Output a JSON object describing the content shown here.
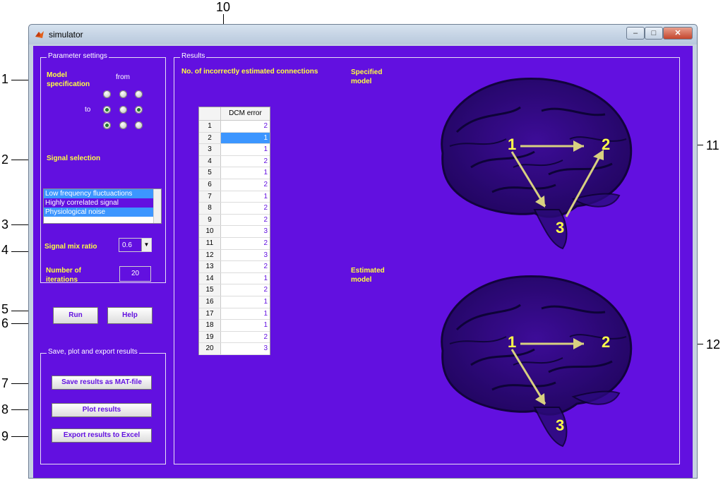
{
  "window": {
    "title": "simulator"
  },
  "titlebar_buttons": {
    "minimize": "–",
    "maximize": "□",
    "close": "✕"
  },
  "callouts": [
    "1",
    "2",
    "3",
    "4",
    "5",
    "6",
    "7",
    "8",
    "9",
    "10",
    "11",
    "12"
  ],
  "parameter_settings": {
    "title": "Parameter settings",
    "model_specification_label": "Model specification",
    "from_label": "from",
    "to_label": "to",
    "radio_grid": [
      [
        false,
        false,
        false
      ],
      [
        true,
        false,
        true
      ],
      [
        true,
        false,
        false
      ]
    ],
    "signal_selection_label": "Signal selection",
    "signal_options": [
      {
        "label": "Low frequency fluctuactions",
        "selected": true
      },
      {
        "label": "Highly correlated signal",
        "selected": false
      },
      {
        "label": "Physiological noise",
        "selected": true
      }
    ],
    "signal_mix_ratio_label": "Signal mix ratio",
    "signal_mix_ratio_value": "0.6",
    "iterations_label": "Number of iterations",
    "iterations_value": "20"
  },
  "actions": {
    "run_label": "Run",
    "help_label": "Help"
  },
  "export_group": {
    "title": "Save, plot and export results",
    "save_label": "Save results as MAT-file",
    "plot_label": "Plot results",
    "export_label": "Export results to Excel"
  },
  "results": {
    "title": "Results",
    "table_title": "No. of incorrectly estimated connections",
    "column_header": "DCM error",
    "rows": [
      {
        "index": "1",
        "value": "2"
      },
      {
        "index": "2",
        "value": "1"
      },
      {
        "index": "3",
        "value": "1"
      },
      {
        "index": "4",
        "value": "2"
      },
      {
        "index": "5",
        "value": "1"
      },
      {
        "index": "6",
        "value": "2"
      },
      {
        "index": "7",
        "value": "1"
      },
      {
        "index": "8",
        "value": "2"
      },
      {
        "index": "9",
        "value": "2"
      },
      {
        "index": "10",
        "value": "3"
      },
      {
        "index": "11",
        "value": "2"
      },
      {
        "index": "12",
        "value": "3"
      },
      {
        "index": "13",
        "value": "2"
      },
      {
        "index": "14",
        "value": "1"
      },
      {
        "index": "15",
        "value": "2"
      },
      {
        "index": "16",
        "value": "1"
      },
      {
        "index": "17",
        "value": "1"
      },
      {
        "index": "18",
        "value": "1"
      },
      {
        "index": "19",
        "value": "2"
      },
      {
        "index": "20",
        "value": "3"
      }
    ],
    "selected_row": 1,
    "specified_model_label": "Specified model",
    "estimated_model_label": "Estimated model",
    "node_labels": [
      "1",
      "2",
      "3"
    ]
  },
  "colors": {
    "background": "#6210e0",
    "label_yellow": "#ffff40",
    "selection": "#3c96ff"
  }
}
